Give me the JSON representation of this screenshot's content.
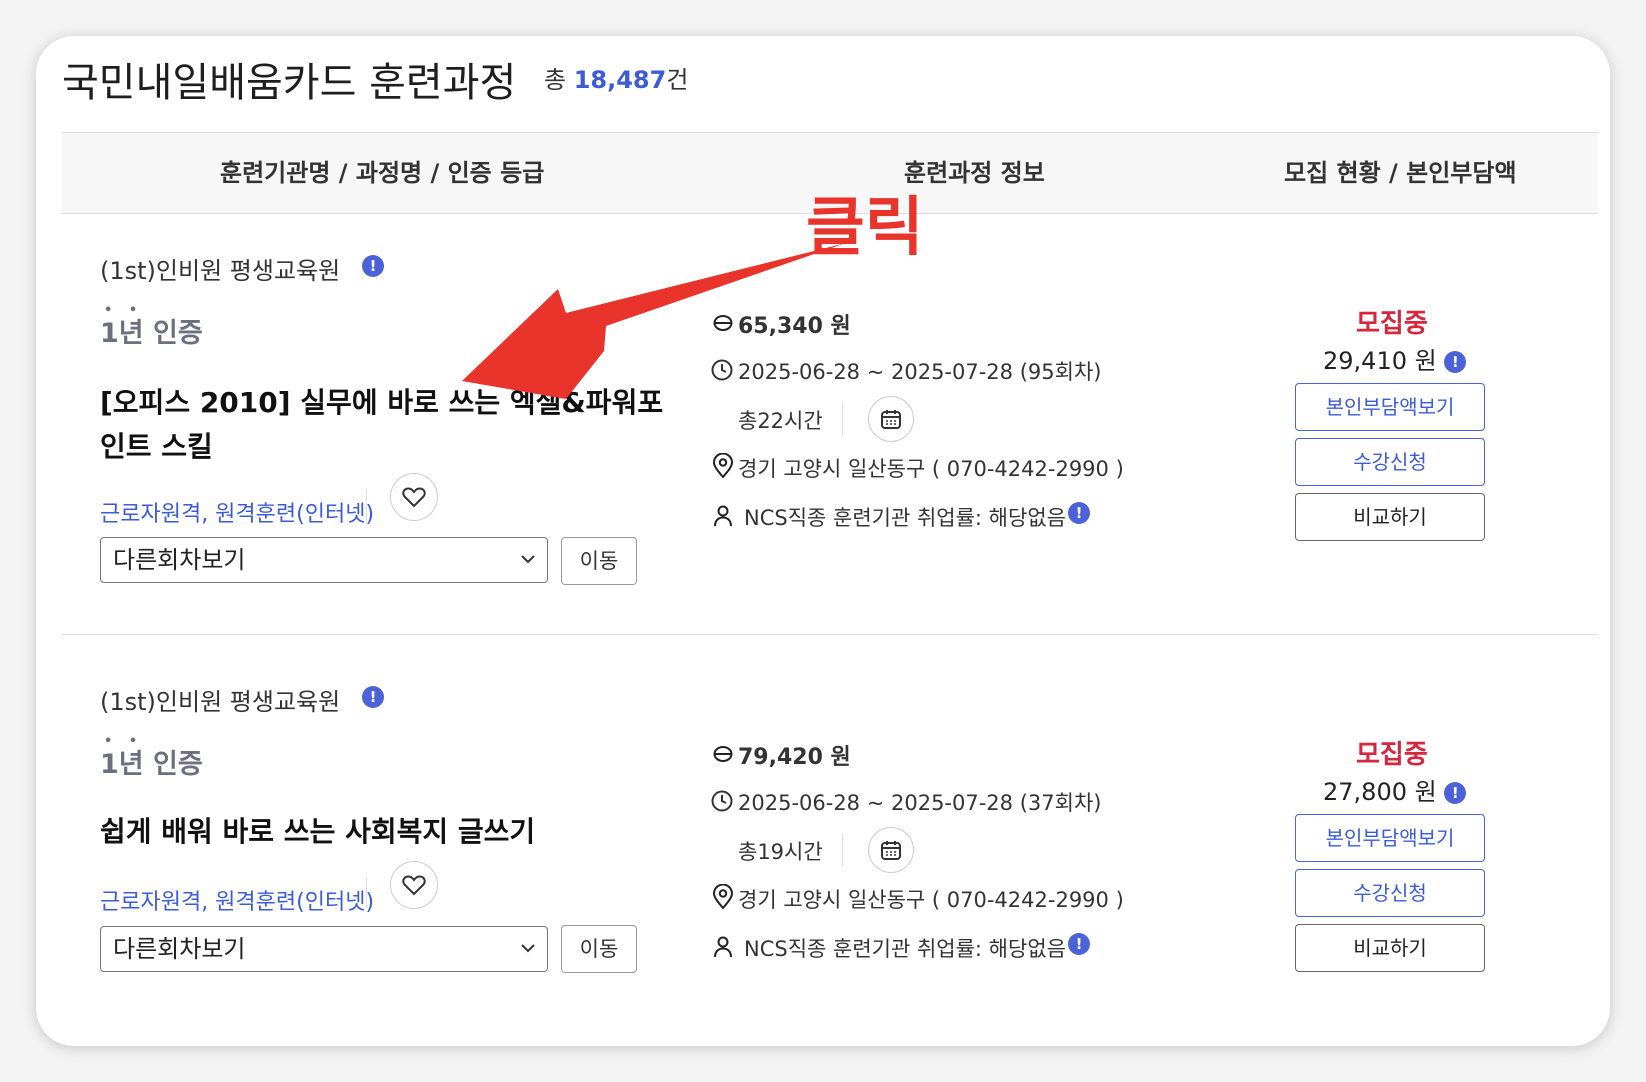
{
  "header": {
    "title": "국민내일배움카드 훈련과정",
    "count_prefix": "총 ",
    "count_value": "18,487",
    "count_suffix": "건"
  },
  "table_header": {
    "col1": "훈련기관명 / 과정명 / 인증 등급",
    "col2": "훈련과정 정보",
    "col3": "모집 현황 / 본인부담액"
  },
  "annotation": {
    "label": "클릭",
    "color": "#e8342a"
  },
  "colors": {
    "accent": "#3b5bd9",
    "status": "#d7263d",
    "info_icon": "#4b62d8"
  },
  "items": [
    {
      "institution": "(1st)인비원 평생교육원",
      "cert_badge": "1년 인증",
      "course_name": "[오피스 2010] 실무에 바로 쓰는 엑셀&파워포인트 스킬",
      "course_type": "근로자원격, 원격훈련(인터넷)",
      "round_select": "다른회차보기",
      "move_label": "이동",
      "price": "65,340 원",
      "period": "2025-06-28 ~ 2025-07-28 (95회차)",
      "hours": "총22시간",
      "location": "경기 고양시 일산동구 ( 070-4242-2990 )",
      "employment_rate": "NCS직종 훈련기관 취업률: 해당없음",
      "status": "모집중",
      "self_pay": "29,410 원",
      "buttons": {
        "self_pay_view": "본인부담액보기",
        "apply": "수강신청",
        "compare": "비교하기"
      }
    },
    {
      "institution": "(1st)인비원 평생교육원",
      "cert_badge": "1년 인증",
      "course_name": "쉽게 배워 바로 쓰는 사회복지 글쓰기",
      "course_type": "근로자원격, 원격훈련(인터넷)",
      "round_select": "다른회차보기",
      "move_label": "이동",
      "price": "79,420 원",
      "period": "2025-06-28 ~ 2025-07-28 (37회차)",
      "hours": "총19시간",
      "location": "경기 고양시 일산동구 ( 070-4242-2990 )",
      "employment_rate": "NCS직종 훈련기관 취업률: 해당없음",
      "status": "모집중",
      "self_pay": "27,800 원",
      "buttons": {
        "self_pay_view": "본인부담액보기",
        "apply": "수강신청",
        "compare": "비교하기"
      }
    }
  ]
}
